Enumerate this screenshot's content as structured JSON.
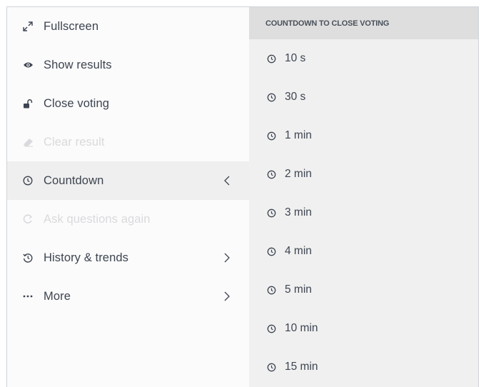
{
  "menu": {
    "items": [
      {
        "icon": "fullscreen-icon",
        "label": "Fullscreen",
        "disabled": false,
        "active": false,
        "has_submenu": false
      },
      {
        "icon": "eye-icon",
        "label": "Show results",
        "disabled": false,
        "active": false,
        "has_submenu": false
      },
      {
        "icon": "unlock-icon",
        "label": "Close voting",
        "disabled": false,
        "active": false,
        "has_submenu": false
      },
      {
        "icon": "eraser-icon",
        "label": "Clear result",
        "disabled": true,
        "active": false,
        "has_submenu": false
      },
      {
        "icon": "clock-icon",
        "label": "Countdown",
        "disabled": false,
        "active": true,
        "has_submenu": true,
        "chevron": "chevron-left-icon"
      },
      {
        "icon": "refresh-icon",
        "label": "Ask questions again",
        "disabled": true,
        "active": false,
        "has_submenu": false
      },
      {
        "icon": "history-icon",
        "label": "History & trends",
        "disabled": false,
        "active": false,
        "has_submenu": true,
        "chevron": "chevron-right-icon"
      },
      {
        "icon": "more-icon",
        "label": "More",
        "disabled": false,
        "active": false,
        "has_submenu": true,
        "chevron": "chevron-right-icon"
      }
    ]
  },
  "countdown": {
    "header": "COUNTDOWN TO CLOSE VOTING",
    "options": [
      "10 s",
      "30 s",
      "1 min",
      "2 min",
      "3 min",
      "4 min",
      "5 min",
      "10 min",
      "15 min"
    ]
  },
  "colors": {
    "text": "#3d4450",
    "disabled_text": "#d8dadd",
    "menu_bg": "#fbfbfb",
    "active_bg": "#efefef",
    "panel_bg": "#f0f0f0",
    "header_bg": "#dedede"
  }
}
